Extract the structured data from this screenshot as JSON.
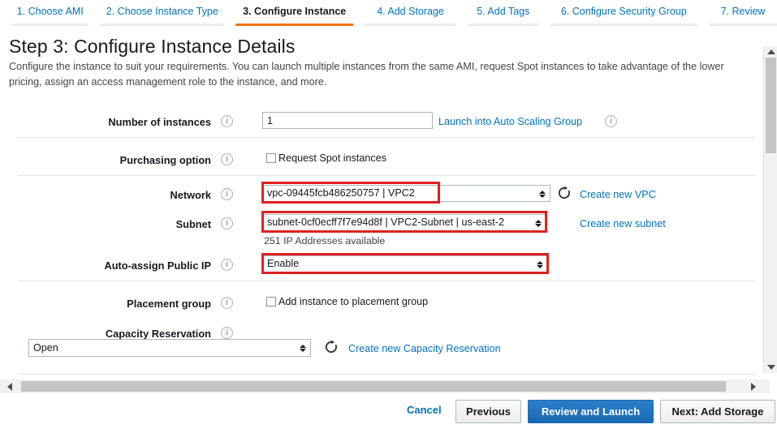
{
  "wizard": {
    "tabs": [
      {
        "label": "1. Choose AMI",
        "active": false
      },
      {
        "label": "2. Choose Instance Type",
        "active": false
      },
      {
        "label": "3. Configure Instance",
        "active": true
      },
      {
        "label": "4. Add Storage",
        "active": false
      },
      {
        "label": "5. Add Tags",
        "active": false
      },
      {
        "label": "6. Configure Security Group",
        "active": false
      },
      {
        "label": "7. Review",
        "active": false
      }
    ],
    "active_accent_color": "#ec7211",
    "link_color": "#0073bb"
  },
  "page": {
    "title": "Step 3: Configure Instance Details",
    "description": "Configure the instance to suit your requirements. You can launch multiple instances from the same AMI, request Spot instances to take advantage of the lower pricing, assign an access management role to the instance, and more."
  },
  "form": {
    "number_of_instances": {
      "label": "Number of instances",
      "value": "1",
      "link": "Launch into Auto Scaling Group"
    },
    "purchasing_option": {
      "label": "Purchasing option",
      "checkbox_label": "Request Spot instances",
      "checked": false
    },
    "network": {
      "label": "Network",
      "value": "vpc-09445fcb486250757 | VPC2",
      "link": "Create new VPC"
    },
    "subnet": {
      "label": "Subnet",
      "value": "subnet-0cf0ecff7f7e94d8f | VPC2-Subnet | us-east-2",
      "link": "Create new subnet",
      "hint": "251 IP Addresses available"
    },
    "auto_assign_public_ip": {
      "label": "Auto-assign Public IP",
      "value": "Enable"
    },
    "placement_group": {
      "label": "Placement group",
      "checkbox_label": "Add instance to placement group",
      "checked": false
    },
    "capacity_reservation": {
      "label": "Capacity Reservation",
      "value": "Open",
      "link": "Create new Capacity Reservation"
    }
  },
  "annotations": {
    "color": "#e02020",
    "boxes": [
      "network-value",
      "subnet-value",
      "auto-assign-public-ip-value"
    ]
  },
  "footer": {
    "cancel": "Cancel",
    "previous": "Previous",
    "review_and_launch": "Review and Launch",
    "next": "Next: Add Storage",
    "primary_color": "#1a68b3"
  },
  "icons": {
    "info": "i",
    "refresh": "refresh-icon"
  }
}
